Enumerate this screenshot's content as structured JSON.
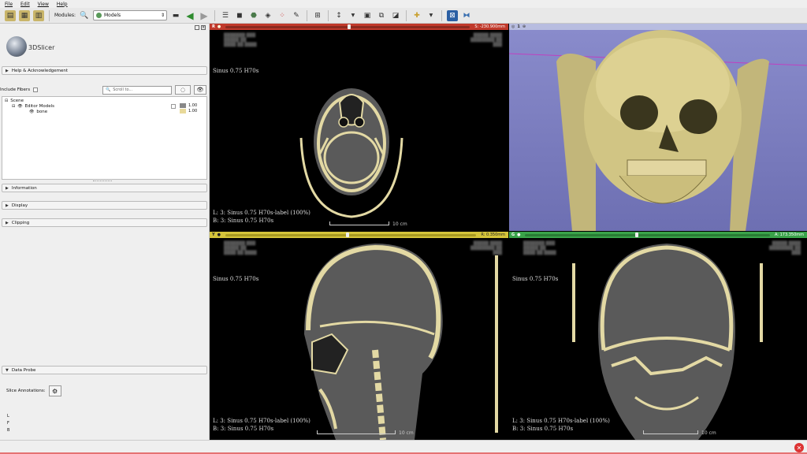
{
  "menu": [
    "File",
    "Edit",
    "View",
    "Help"
  ],
  "toolbar": {
    "modules_label": "Modules:",
    "module_selected": "Models",
    "icons": [
      "load-data-icon",
      "load-dicom-icon",
      "save-icon",
      "search-icon",
      "back-icon",
      "forward-icon",
      "layout-icon",
      "volume-icon",
      "models-icon",
      "transform-icon",
      "markups-icon",
      "editor-icon",
      "layout-grid-icon",
      "mouse-mode-icon",
      "screenshot-icon",
      "crosshair-icon",
      "extension-icon",
      "python-icon"
    ]
  },
  "logo": {
    "text": "3DSlicer"
  },
  "left_panel": {
    "help_label": "Help & Acknowledgement",
    "include_fibers_label": "Include Fibers",
    "scroll_placeholder": "Scroll to...",
    "tree": {
      "scene": "Scene",
      "editor_models": "Editor Models",
      "bone": "bone",
      "opacity_1": "1.00",
      "opacity_2": "1.00"
    },
    "information_label": "Information",
    "display_label": "Display",
    "clipping_label": "Clipping",
    "data_probe_label": "Data Probe",
    "slice_annotations_label": "Slice Annotations:",
    "probe_letters": [
      "L",
      "F",
      "B"
    ]
  },
  "colors": {
    "red": "#c0392b",
    "yellow": "#d4c43a",
    "green": "#3aa34a",
    "bone": "#e3d9a4",
    "blue3d": "#7d7fbe"
  },
  "views": {
    "red": {
      "letter": "R",
      "slice_value": "S: -230.900mm",
      "top_label": "Sinus  0.75  H70s",
      "bottom_l": "L: 3: Sinus  0.75  H70s-label (100%)",
      "bottom_b": "B: 3: Sinus  0.75  H70s",
      "scale": "10 cm"
    },
    "threed": {
      "letter": "1"
    },
    "yellow": {
      "letter": "Y",
      "slice_value": "R: 0.350mm",
      "top_label": "Sinus  0.75  H70s",
      "bottom_l": "L: 3: Sinus  0.75  H70s-label (100%)",
      "bottom_b": "B: 3: Sinus  0.75  H70s",
      "scale": "10 cm"
    },
    "green": {
      "letter": "G",
      "slice_value": "A: 173.350mm",
      "top_label": "Sinus  0.75  H70s",
      "bottom_l": "L: 3: Sinus  0.75  H70s-label (100%)",
      "bottom_b": "B: 3: Sinus  0.75  H70s",
      "scale": "10 cm"
    }
  }
}
